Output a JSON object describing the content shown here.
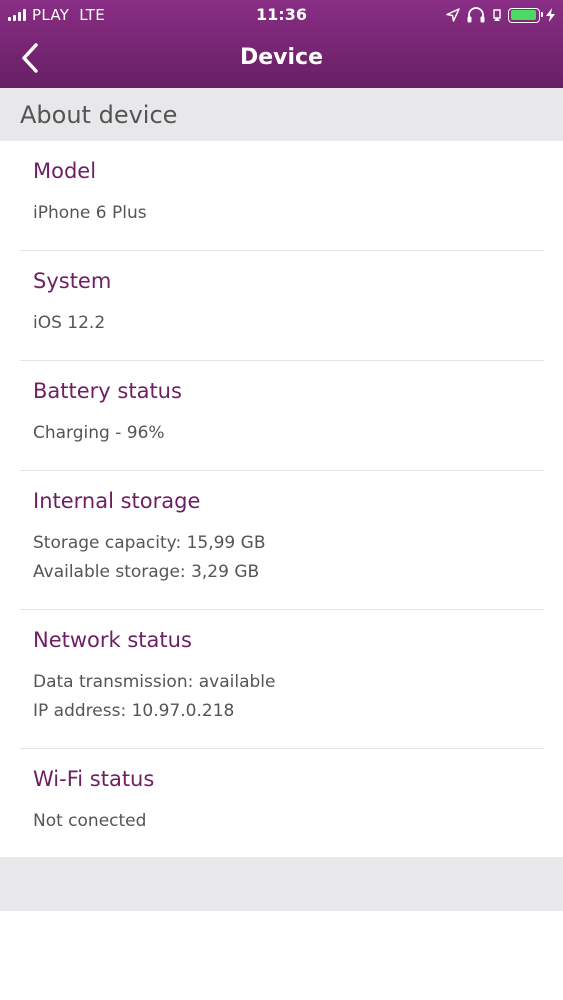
{
  "status_bar": {
    "carrier": "PLAY",
    "network": "LTE",
    "time": "11:36",
    "battery_level": 0.96,
    "battery_color": "#4cd964"
  },
  "navbar": {
    "title": "Device",
    "back_icon": "chevron-left-icon",
    "background_color": "#7a2775"
  },
  "section": {
    "title": "About device"
  },
  "items": [
    {
      "title": "Model",
      "lines": [
        "iPhone 6 Plus"
      ]
    },
    {
      "title": "System",
      "lines": [
        "iOS 12.2"
      ]
    },
    {
      "title": "Battery status",
      "lines": [
        "Charging - 96%"
      ]
    },
    {
      "title": "Internal storage",
      "lines": [
        "Storage capacity: 15,99 GB",
        "Available storage: 3,29 GB"
      ]
    },
    {
      "title": "Network status",
      "lines": [
        "Data transmission: available",
        "IP address: 10.97.0.218"
      ]
    },
    {
      "title": "Wi-Fi status",
      "lines": [
        "Not conected"
      ]
    }
  ]
}
